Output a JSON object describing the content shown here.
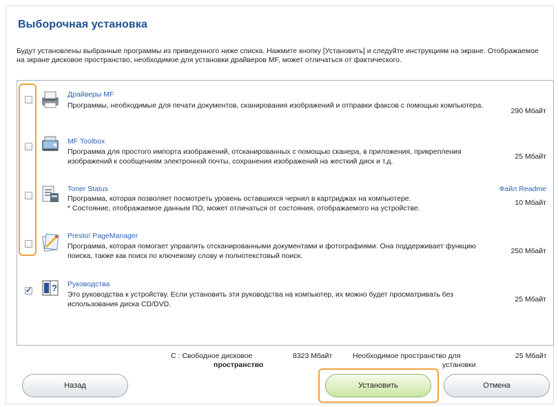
{
  "title": "Выборочная установка",
  "intro": "Будут установлены выбранные программы из приведенного ниже списка. Нажмите кнопку [Установить] и следуйте инструкциям на экране. Отображаемое на экране дисковое пространство, необходимое для установки драйверов MF, может отличаться от фактического.",
  "items": [
    {
      "name": "Драйверы MF",
      "description": "Программы, необходимые для печати документов, сканирования изображений и отправки факсов с помощью компьютера.",
      "size": "290 Мбайт",
      "checked": false,
      "icon": "printer-driver-icon"
    },
    {
      "name": "MF Toolbox",
      "description": "Программа для простого импорта изображений, отсканированных с помощью сканера, в приложения, прикрепления изображений к сообщениям электронной почты, сохранения изображений на жесткий диск и т.д.",
      "size": "25 Мбайт",
      "checked": false,
      "icon": "toolbox-icon"
    },
    {
      "name": "Toner Status",
      "description": "Программа, которая позволяет посмотреть уровень оставшихся чернил в картриджах на компьютере.\n* Состояние, отображаемое данным ПО, может отличаться от состояния, отображаемого на устройстве.",
      "size": "10 Мбайт",
      "checked": false,
      "readme": "Файл Readme",
      "icon": "toner-status-icon"
    },
    {
      "name": "Presto! PageManager",
      "description": "Программа, которая помогает управлять отсканированными документами и фотографиями. Она поддерживает функцию поиска, также как поиск по ключевому слову и полнотекстовый поиск.",
      "size": "250 Мбайт",
      "checked": false,
      "icon": "page-manager-icon"
    },
    {
      "name": "Руководства",
      "description": "Это руководства к устройству. Если установить эти руководства на компьютер, их можно будет просматривать без использования диска CD/DVD.",
      "size": "25 Мбайт",
      "checked": true,
      "icon": "manuals-icon"
    }
  ],
  "footer": {
    "drive_label_1": "C : Свободное дисковое",
    "drive_label_2": "пространство",
    "free_space": "8323 Мбайт",
    "required_label_1": "Необходимое пространство для",
    "required_label_2": "установки",
    "required_space": "25 Мбайт"
  },
  "buttons": {
    "back": "Назад",
    "install": "Установить",
    "cancel": "Отмена"
  }
}
